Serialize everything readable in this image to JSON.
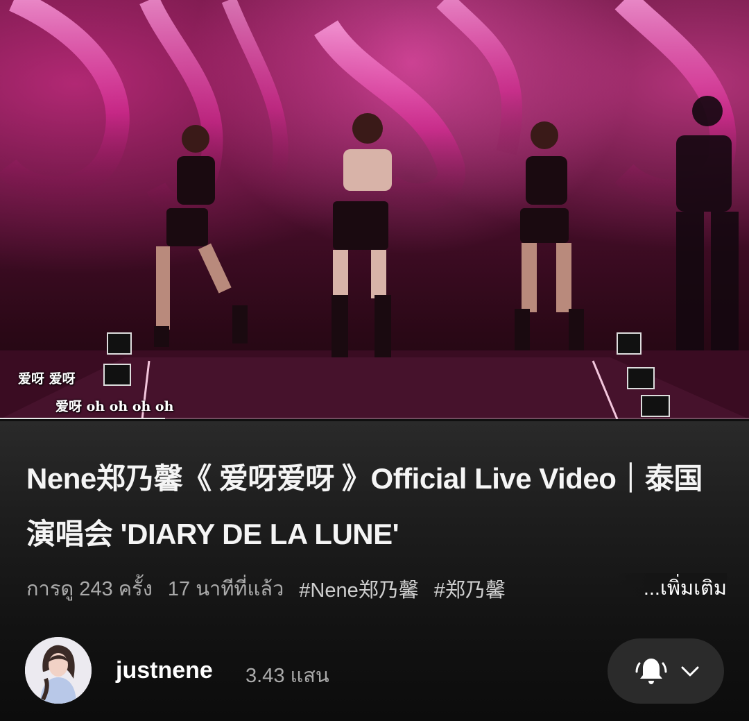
{
  "video": {
    "lyrics_line1": "爱呀  爱呀",
    "lyrics_line2": "爱呀 oh oh oh oh",
    "progress_fraction": 0.22
  },
  "title": "Nene郑乃馨《 爱呀爱呀 》Official Live Video｜泰国演唱会 'DIARY DE LA LUNE'",
  "meta": {
    "views": "การดู 243 ครั้ง",
    "age": "17 นาทีที่แล้ว",
    "tags": [
      "#Nene郑乃馨",
      "#郑乃馨"
    ],
    "more_label": "...เพิ่มเติม"
  },
  "channel": {
    "name": "justnene",
    "subscribers": "3.43 แสน",
    "avatar_icon": "avatar-photo"
  },
  "subscribe_button": {
    "bell_icon": "bell-icon",
    "chevron_icon": "chevron-down-icon"
  },
  "colors": {
    "background": "#0f0f0f",
    "secondary_text": "#aaaaaa",
    "button_bg": "#2b2b2b"
  }
}
